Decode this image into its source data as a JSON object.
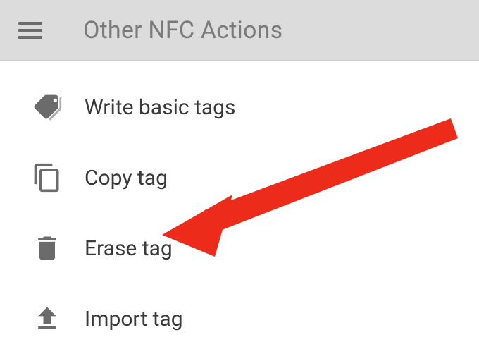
{
  "header": {
    "title": "Other NFC Actions"
  },
  "menu": {
    "items": [
      {
        "label": "Write basic tags",
        "icon": "tags-icon"
      },
      {
        "label": "Copy tag",
        "icon": "copy-icon"
      },
      {
        "label": "Erase tag",
        "icon": "trash-icon"
      },
      {
        "label": "Import tag",
        "icon": "upload-icon"
      }
    ]
  },
  "annotation": {
    "target": "erase-tag",
    "color": "#ED2B1A"
  }
}
